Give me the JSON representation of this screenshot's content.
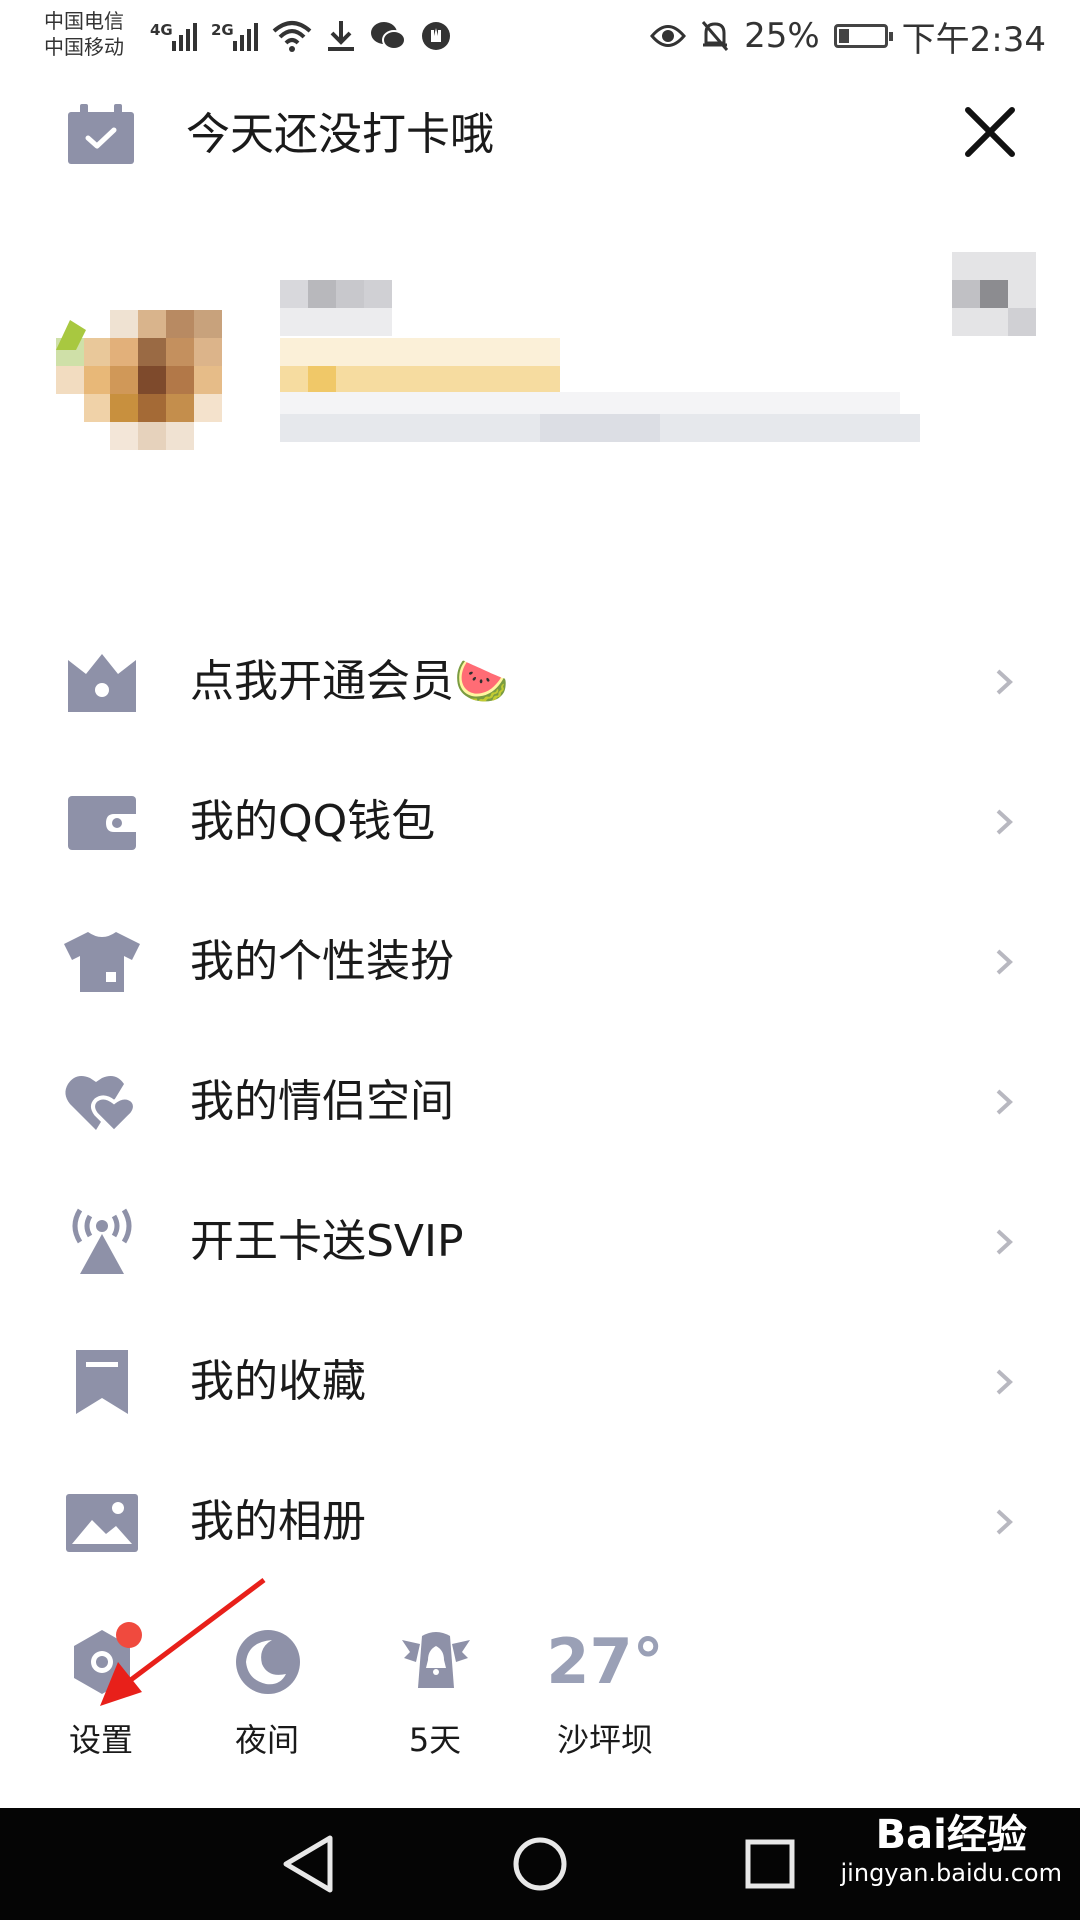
{
  "status_bar": {
    "carrier_1": "中国电信",
    "carrier_2": "中国移动",
    "network_1": "4G",
    "network_2": "2G",
    "battery": "25%",
    "time": "下午2:34",
    "icons": [
      "signal-icon",
      "signal-icon",
      "wifi-icon",
      "download-icon",
      "wechat-icon",
      "shield-icon",
      "eye-icon",
      "bell-off-icon",
      "battery-icon"
    ]
  },
  "header": {
    "title": "今天还没打卡哦",
    "checkin_icon": "calendar-check-icon",
    "close_icon": "close-icon"
  },
  "menu": {
    "items": [
      {
        "label": "点我开通会员",
        "emoji": "🍉",
        "icon": "crown-icon"
      },
      {
        "label": "我的QQ钱包",
        "icon": "wallet-icon"
      },
      {
        "label": "我的个性装扮",
        "icon": "shirt-icon"
      },
      {
        "label": "我的情侣空间",
        "icon": "hearts-icon"
      },
      {
        "label": "开王卡送SVIP",
        "icon": "broadcast-icon"
      },
      {
        "label": "我的收藏",
        "icon": "bookmark-icon"
      },
      {
        "label": "我的相册",
        "icon": "image-icon"
      }
    ]
  },
  "toolbar": {
    "settings": "设置",
    "night": "夜间",
    "checkin_days": "5天",
    "temperature": "27°",
    "location": "沙坪坝"
  },
  "watermark": {
    "brand": "Bai经验",
    "url": "jingyan.baidu.com"
  },
  "colors": {
    "icon_gray": "#8e91a8",
    "badge_red": "#f04a3e",
    "arrow_red": "#e8201a",
    "nav_bg": "#050505"
  }
}
